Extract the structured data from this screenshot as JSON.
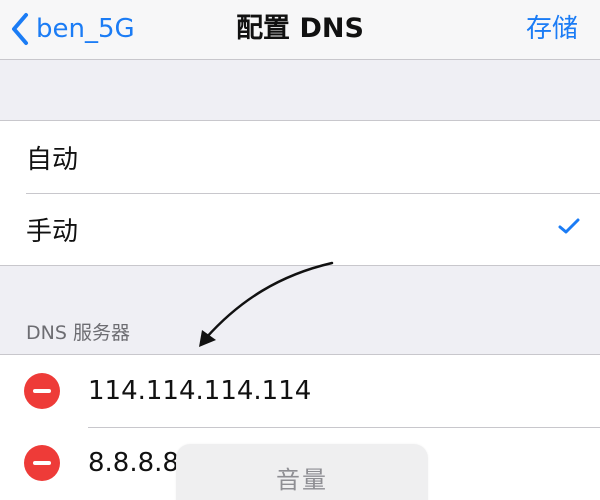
{
  "nav": {
    "back_label": "ben_5G",
    "title": "配置 DNS",
    "save_label": "存储"
  },
  "mode": {
    "options": [
      {
        "label": "自动",
        "selected": false
      },
      {
        "label": "手动",
        "selected": true
      }
    ]
  },
  "dns": {
    "section_header": "DNS 服务器",
    "servers": [
      "114.114.114.114",
      "8.8.8.8"
    ]
  },
  "hud": {
    "label": "音量"
  },
  "colors": {
    "accent": "#1b7cf5",
    "delete": "#ee3b38",
    "background": "#efeff4"
  },
  "icons": {
    "back": "chevron-left-icon",
    "selected": "checkmark-icon",
    "delete": "minus-circle-icon",
    "annotation": "curved-arrow-icon"
  }
}
